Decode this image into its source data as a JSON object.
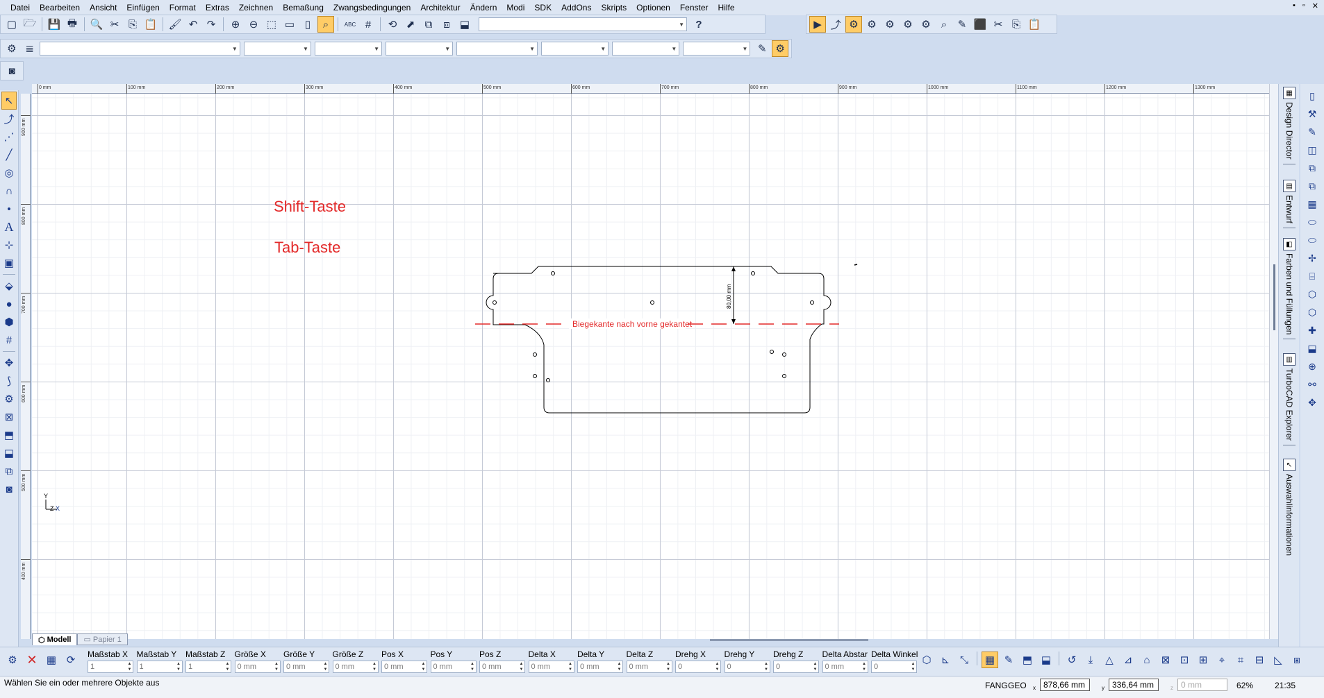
{
  "menu": [
    "Datei",
    "Bearbeiten",
    "Ansicht",
    "Einfügen",
    "Format",
    "Extras",
    "Zeichnen",
    "Bemaßung",
    "Zwangsbedingungen",
    "Architektur",
    "Ändern",
    "Modi",
    "SDK",
    "AddOns",
    "Skripts",
    "Optionen",
    "Fenster",
    "Hilfe"
  ],
  "window_controls": [
    "▪",
    "▫",
    "✕"
  ],
  "toolbar1": [
    "▢",
    "🗁",
    "💾",
    "🖶",
    "🔍",
    "✂",
    "⎘",
    "📋",
    "🖌",
    "↶",
    "↷",
    "⊕",
    "⊖",
    "⬚",
    "▭",
    "▯",
    "⌕",
    "ABC",
    "#",
    "⟲",
    "⬈",
    "⧉",
    "⧈",
    "⬓"
  ],
  "toolbar2": [
    "▶",
    "⤴",
    "⚙",
    "⚙",
    "⚙",
    "⚙",
    "⚙",
    "⌕",
    "✎",
    "⬛",
    "✂",
    "⎘",
    "📋"
  ],
  "help_icon": "?",
  "ruler_h": [
    "0 mm",
    "100 mm",
    "200 mm",
    "300 mm",
    "400 mm",
    "500 mm",
    "600 mm",
    "700 mm",
    "800 mm",
    "900 mm",
    "1000 mm",
    "1100 mm",
    "1200 mm",
    "1300 mm"
  ],
  "ruler_v": [
    "900 mm",
    "800 mm",
    "700 mm",
    "600 mm",
    "500 mm",
    "400 mm"
  ],
  "canvas": {
    "text_shift": "Shift-Taste",
    "text_tab": "Tab-Taste",
    "bend_label": "Biegekante nach vorne gekantet",
    "dim_label": "80,00 mm",
    "axis_y": "Y",
    "axis_z": "Z",
    "axis_x": "X",
    "colors": {
      "annotation": "#e32a2a",
      "geometry": "#000000",
      "grid": "#c5cad6"
    }
  },
  "tabs": [
    {
      "label": "Modell",
      "active": true
    },
    {
      "label": "Papier 1",
      "active": false
    }
  ],
  "right_panels": [
    "Design Director",
    "Entwurf",
    "Farben und Füllungen",
    "TurboCAD Explorer",
    "Auswahlinformationen"
  ],
  "inspector_fields": [
    {
      "label": "Maßstab X",
      "value": "1"
    },
    {
      "label": "Maßstab Y",
      "value": "1"
    },
    {
      "label": "Maßstab Z",
      "value": "1"
    },
    {
      "label": "Größe X",
      "value": "0 mm"
    },
    {
      "label": "Größe Y",
      "value": "0 mm"
    },
    {
      "label": "Größe Z",
      "value": "0 mm"
    },
    {
      "label": "Pos X",
      "value": "0 mm"
    },
    {
      "label": "Pos Y",
      "value": "0 mm"
    },
    {
      "label": "Pos Z",
      "value": "0 mm"
    },
    {
      "label": "Delta X",
      "value": "0 mm"
    },
    {
      "label": "Delta Y",
      "value": "0 mm"
    },
    {
      "label": "Delta Z",
      "value": "0 mm"
    },
    {
      "label": "Drehg X",
      "value": "0"
    },
    {
      "label": "Drehg Y",
      "value": "0"
    },
    {
      "label": "Drehg Z",
      "value": "0"
    },
    {
      "label": "Delta Abstar",
      "value": "0 mm"
    },
    {
      "label": "Delta Winkel",
      "value": "0"
    }
  ],
  "status": {
    "message": "Wählen Sie ein oder mehrere Objekte aus",
    "snap": "FANG",
    "geo": "GEO",
    "coord_x": "878,66 mm",
    "coord_y": "336,64 mm",
    "coord_z": "0 mm",
    "zoom": "62%",
    "time": "21:35"
  }
}
